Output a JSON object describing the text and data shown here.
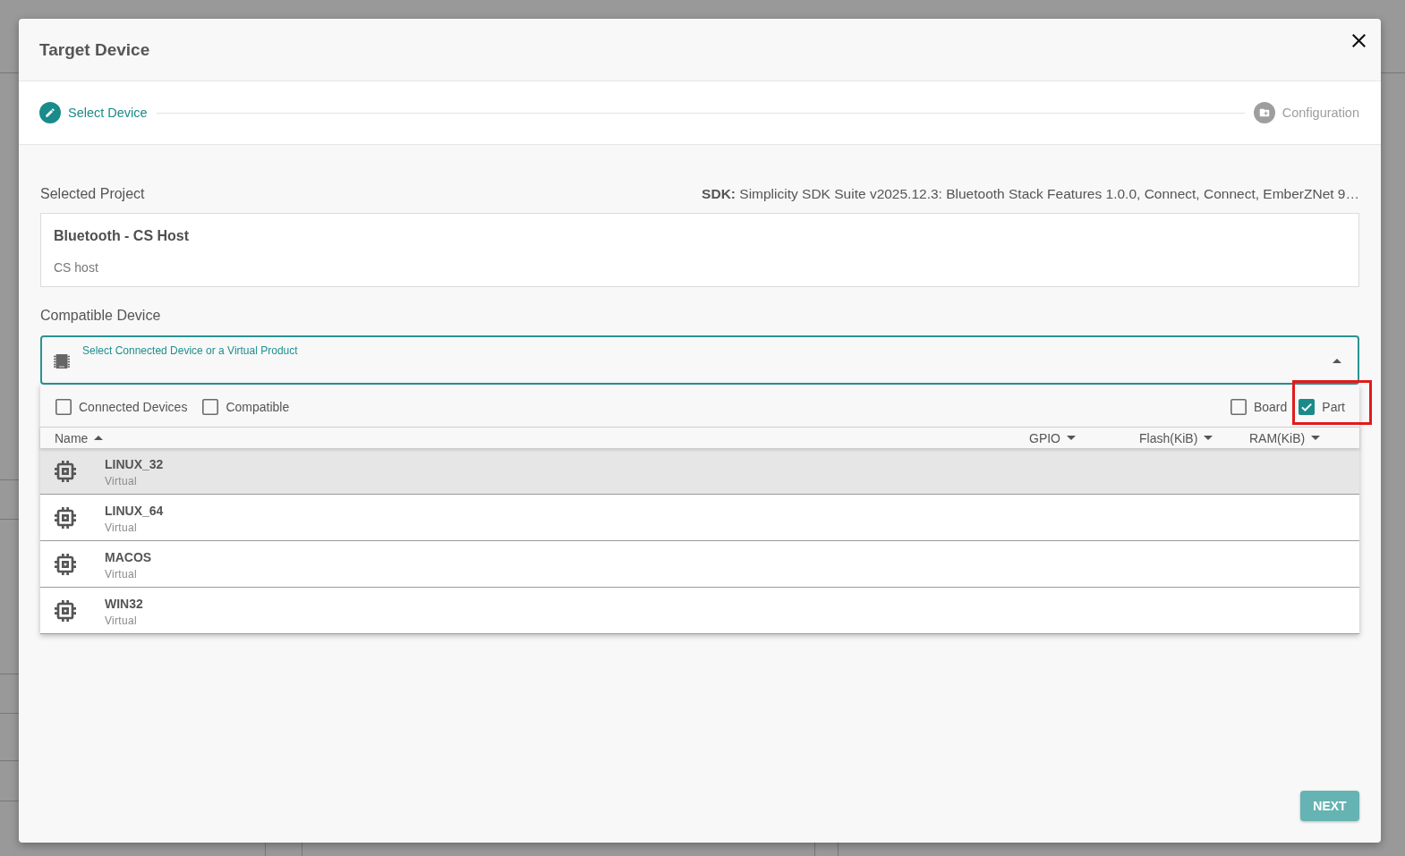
{
  "dialog": {
    "title": "Target Device"
  },
  "steps": [
    {
      "label": "Select Device",
      "active": true
    },
    {
      "label": "Configuration",
      "active": false
    }
  ],
  "project": {
    "label": "Selected Project",
    "sdk": "**SDK:** Simplicity SDK Suite v2025.12.3: Bluetooth Stack Features 1.0.0, Connect, Connect, EmberZNet 9…",
    "name": "Bluetooth - CS Host",
    "description": "CS host"
  },
  "device": {
    "label": "Compatible Device",
    "field_label": "Select Connected Device or a Virtual Product",
    "expanded": true,
    "filters_left": [
      {
        "label": "Connected Devices",
        "checked": false,
        "highlighted": false
      },
      {
        "label": "Compatible",
        "checked": false,
        "highlighted": false
      }
    ],
    "filters_right": [
      {
        "label": "Board",
        "checked": false,
        "highlighted": false
      },
      {
        "label": "Part",
        "checked": true,
        "highlighted": true
      }
    ],
    "columns": [
      {
        "label": "Name",
        "ascending": true
      },
      {
        "label": "GPIO",
        "ascending": false
      },
      {
        "label": "Flash(KiB)",
        "ascending": false
      },
      {
        "label": "RAM(KiB)",
        "ascending": false
      }
    ],
    "rows": [
      {
        "name": "LINUX_32",
        "category": "Virtual",
        "selected": true
      },
      {
        "name": "LINUX_64",
        "category": "Virtual",
        "selected": false
      },
      {
        "name": "MACOS",
        "category": "Virtual",
        "selected": false
      },
      {
        "name": "WIN32",
        "category": "Virtual",
        "selected": false
      }
    ]
  },
  "footer": {
    "next": {
      "label": "NEXT",
      "disabled": true
    }
  }
}
